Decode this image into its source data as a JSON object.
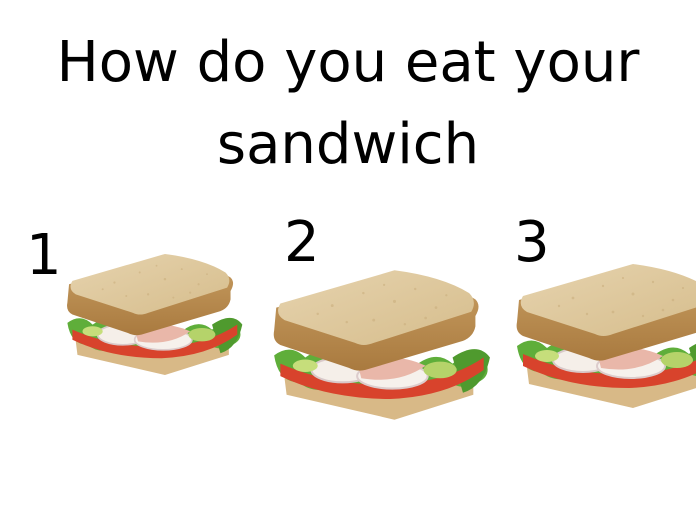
{
  "title": "How do you eat your sandwich",
  "options": [
    {
      "number": "1",
      "image": "sandwich-image"
    },
    {
      "number": "2",
      "image": "sandwich-image"
    },
    {
      "number": "3",
      "image": "sandwich-image"
    }
  ]
}
